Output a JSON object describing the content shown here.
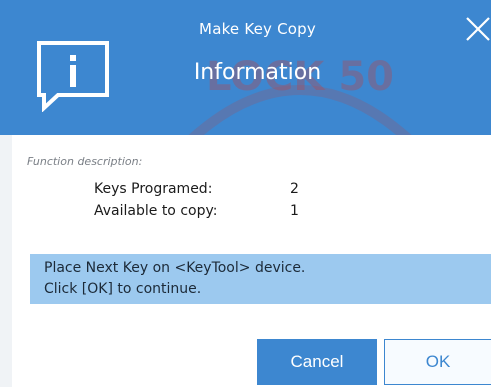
{
  "dialog": {
    "title": "Make Key Copy",
    "heading": "Information",
    "icon": "info-speech-bubble-icon",
    "close_icon": "close-icon"
  },
  "watermark": {
    "text": "LOCK 50"
  },
  "content": {
    "function_description_label": "Function description:",
    "rows": [
      {
        "label": "Keys Programed:",
        "value": "2"
      },
      {
        "label": "Available to copy:",
        "value": "1"
      }
    ]
  },
  "message": {
    "line1": "Place Next Key on <KeyTool> device.",
    "line2": "Click [OK] to continue."
  },
  "buttons": {
    "cancel": "Cancel",
    "ok": "OK"
  },
  "colors": {
    "accent": "#3d87d0",
    "message_bg": "#9cc9ef",
    "watermark": "#b8454a"
  }
}
